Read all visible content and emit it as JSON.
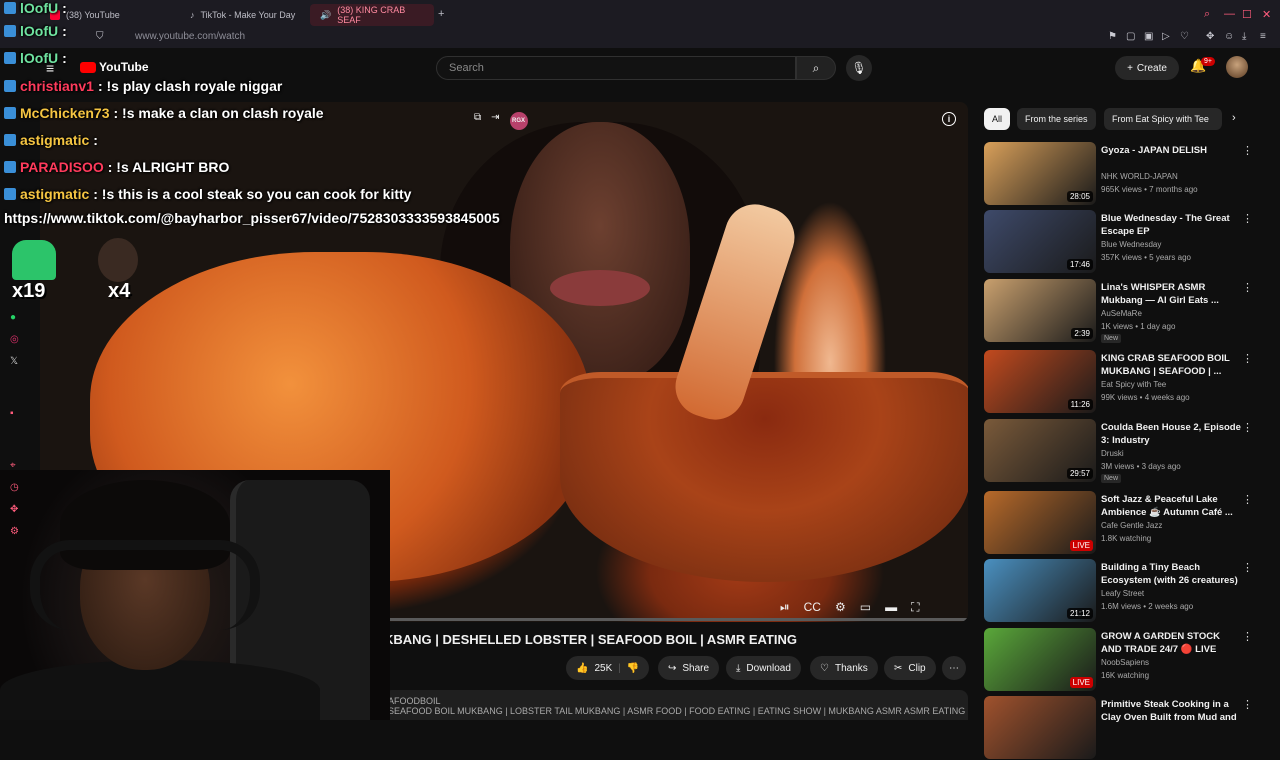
{
  "browser": {
    "tabs": [
      {
        "label": "(38) YouTube"
      },
      {
        "label": "TikTok - Make Your Day"
      },
      {
        "label": "(38) KING CRAB SEAF"
      }
    ],
    "new_tab": "+",
    "url": "www.youtube.com/watch"
  },
  "youtube": {
    "logo": "YouTube",
    "search_placeholder": "Search",
    "create_label": "Create",
    "notification_count": "9+"
  },
  "video": {
    "title": "KBANG | DESHELLED LOBSTER | SEAFOOD BOIL | ASMR EATING",
    "overlay_badge": "RGX",
    "progress": 0.34,
    "actions": {
      "likes": "25K",
      "share": "Share",
      "download": "Download",
      "thanks": "Thanks",
      "clip": "Clip"
    },
    "description_line1": "AFOODBOIL",
    "description_line2": "SEAFOOD BOIL MUKBANG | LOBSTER TAIL MUKBANG | ASMR FOOD | FOOD EATING | EATING SHOW | MUKBANG ASMR ASMR EATING"
  },
  "chips": [
    {
      "label": "All"
    },
    {
      "label": "From the series"
    },
    {
      "label": "From Eat Spicy with Tee"
    }
  ],
  "recommendations": [
    {
      "title": "Gyoza - JAPAN DELISH",
      "channel": "NHK WORLD-JAPAN",
      "meta": "965K views • 7 months ago",
      "duration": "28:05",
      "badge": "",
      "thumb_color": "#d9a05a"
    },
    {
      "title": "Blue Wednesday - The Great Escape EP",
      "channel": "Blue Wednesday",
      "meta": "357K views • 5 years ago",
      "duration": "17:46",
      "badge": "",
      "thumb_color": "#3e4a6a"
    },
    {
      "title": "Lina's WHISPER ASMR Mukbang — Al Girl Eats ...",
      "channel": "AuSeMaRe",
      "meta": "1K views • 1 day ago",
      "duration": "2:39",
      "badge": "New",
      "thumb_color": "#c9a06e"
    },
    {
      "title": "KING CRAB SEAFOOD BOIL MUKBANG | SEAFOOD | ...",
      "channel": "Eat Spicy with Tee",
      "meta": "99K views • 4 weeks ago",
      "duration": "11:26",
      "badge": "",
      "thumb_color": "#c24a1e"
    },
    {
      "title": "Coulda Been House 2, Episode 3: Industry",
      "channel": "Druski",
      "meta": "3M views • 3 days ago",
      "duration": "29:57",
      "badge": "New",
      "thumb_color": "#7a5a3a"
    },
    {
      "title": "Soft Jazz & Peaceful Lake Ambience ☕ Autumn Café ...",
      "channel": "Cafe Gentle Jazz",
      "meta": "1.8K watching",
      "duration": "LIVE",
      "badge": "",
      "thumb_color": "#b86a2a"
    },
    {
      "title": "Building a Tiny Beach Ecosystem (with 26 creatures)",
      "channel": "Leafy Street",
      "meta": "1.6M views • 2 weeks ago",
      "duration": "21:12",
      "badge": "",
      "thumb_color": "#4a90c0"
    },
    {
      "title": "GROW A GARDEN STOCK AND TRADE 24/7 🔴 LIVE",
      "channel": "NoobSapiens",
      "meta": "16K watching",
      "duration": "LIVE",
      "badge": "",
      "thumb_color": "#5aa83a"
    },
    {
      "title": "Primitive Steak Cooking in a Clay Oven Built from Mud and",
      "channel": "",
      "meta": "",
      "duration": "",
      "badge": "",
      "thumb_color": "#a0522d"
    }
  ],
  "chat": [
    {
      "user": "lOofU",
      "message": ":",
      "color": "#6fe3a0"
    },
    {
      "user": "lOofU",
      "message": ":",
      "color": "#6fe3a0"
    },
    {
      "user": "lOofU",
      "message": ":",
      "color": "#6fe3a0"
    },
    {
      "user": "christianv1",
      "message": ": !s play clash royale niggar",
      "color": "#ff3b5c"
    },
    {
      "user": "McChicken73",
      "message": ": !s make a clan on clash royale",
      "color": "#f5c542"
    },
    {
      "user": "astigmatic",
      "message": ":",
      "color": "#f5c542"
    },
    {
      "user": "PARADISOO",
      "message": ": !s ALRIGHT BRO",
      "color": "#ff3b5c"
    },
    {
      "user": "astigmatic",
      "message": ": !s this is a cool steak so you can cook for kitty",
      "color": "#f5c542"
    }
  ],
  "chat_link": "https://www.tiktok.com/@bayharbor_pisser67/video/7528303333593845005",
  "emotes": [
    {
      "count": "x19"
    },
    {
      "count": "x4"
    }
  ],
  "colors": {
    "yt_red": "#ff0000",
    "accent_pink": "#ff5c7c"
  }
}
